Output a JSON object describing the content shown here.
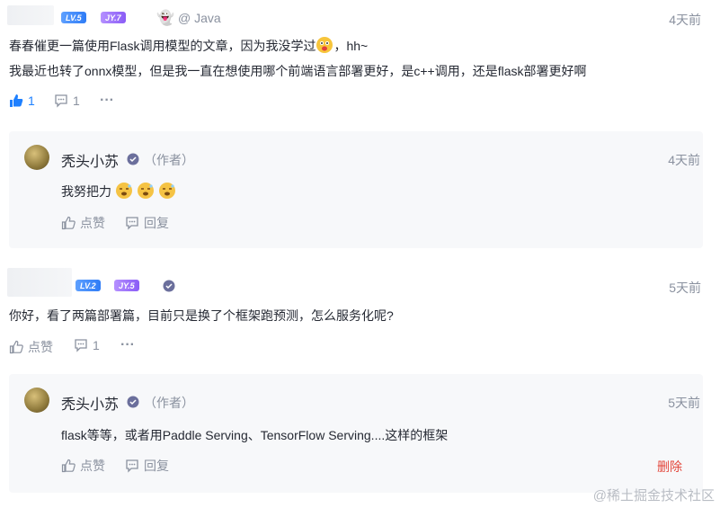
{
  "comments": [
    {
      "username": "",
      "level_badge": "LV.5",
      "jy_badge": "JY.7",
      "group": "@ Java",
      "time": "4天前",
      "text_line1": "春春催更一篇使用Flask调用模型的文章，因为我没学过",
      "text_line1_after": "，hh~",
      "text_line2": "我最近也转了onnx模型，但是我一直在想使用哪个前端语言部署更好，是c++调用，还是flask部署更好啊",
      "like_count": "1",
      "comment_count": "1",
      "more": "···",
      "reply": {
        "author": "秃头小苏",
        "tag": "（作者）",
        "time": "4天前",
        "text": "我努把力",
        "like_label": "点赞",
        "reply_label": "回复"
      }
    },
    {
      "username": "",
      "level_badge": "LV.2",
      "jy_badge": "JY.5",
      "time": "5天前",
      "text": "你好，看了两篇部署篇，目前只是换了个框架跑预测，怎么服务化呢?",
      "like_label": "点赞",
      "comment_count": "1",
      "more": "···",
      "reply": {
        "author": "秃头小苏",
        "tag": "（作者）",
        "time": "5天前",
        "text": "flask等等，或者用Paddle Serving、TensorFlow Serving....这样的框架",
        "like_label": "点赞",
        "reply_label": "回复",
        "delete_label": "删除"
      }
    }
  ],
  "watermark": "@稀土掘金技术社区",
  "colors": {
    "accent": "#1e80ff",
    "muted": "#8a919f",
    "danger": "#e3463b",
    "reply_bg": "#f7f8fa"
  }
}
